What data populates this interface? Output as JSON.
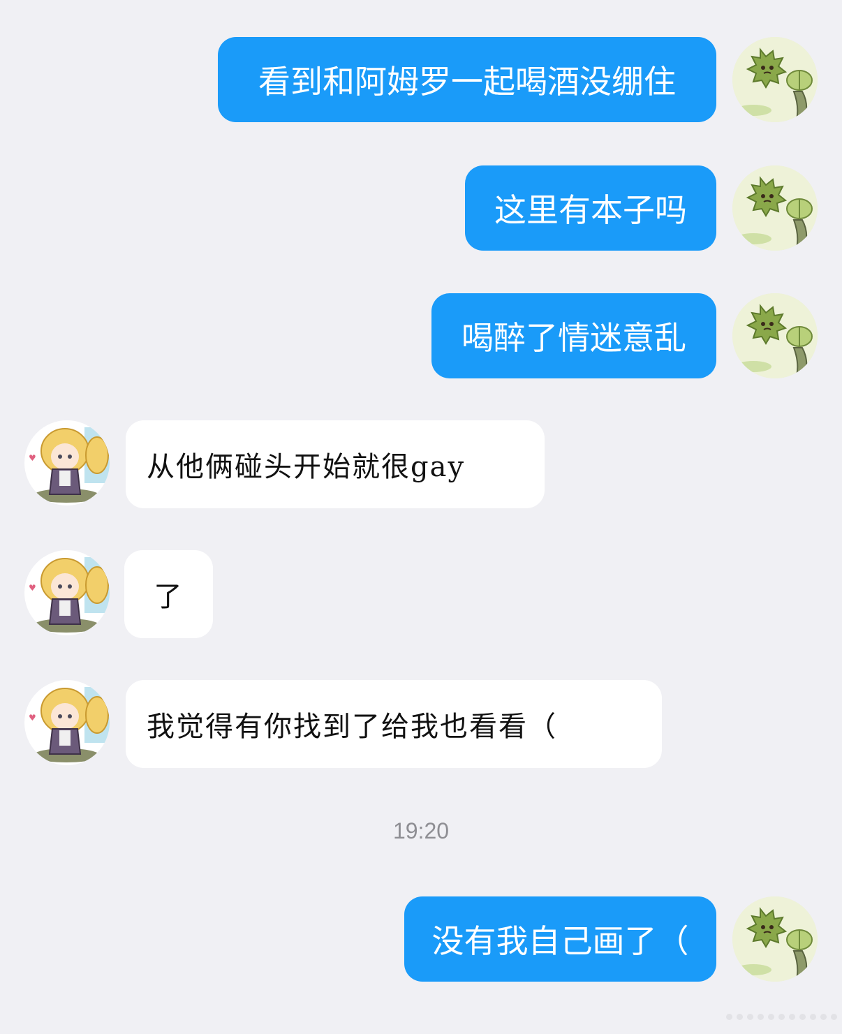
{
  "chat": {
    "messages": [
      {
        "direction": "outgoing",
        "text": "看到和阿姆罗一起喝酒没绷住",
        "avatar_icon": "durian-character-icon"
      },
      {
        "direction": "outgoing",
        "text": "这里有本子吗",
        "avatar_icon": "durian-character-icon"
      },
      {
        "direction": "outgoing",
        "text": "喝醉了情迷意乱",
        "avatar_icon": "durian-character-icon"
      },
      {
        "direction": "incoming",
        "text": "从他俩碰头开始就很gay",
        "avatar_icon": "anime-blonde-character-icon"
      },
      {
        "direction": "incoming",
        "text": "了",
        "avatar_icon": "anime-blonde-character-icon"
      },
      {
        "direction": "incoming",
        "text": "我觉得有你找到了给我也看看（",
        "avatar_icon": "anime-blonde-character-icon"
      },
      {
        "direction": "outgoing",
        "text": "没有我自己画了（",
        "avatar_icon": "durian-character-icon"
      }
    ],
    "timestamp": "19:20"
  },
  "colors": {
    "background": "#f0f0f4",
    "outgoing_bubble": "#1a9bf9",
    "incoming_bubble": "#ffffff",
    "timestamp_text": "#8e8e93"
  }
}
